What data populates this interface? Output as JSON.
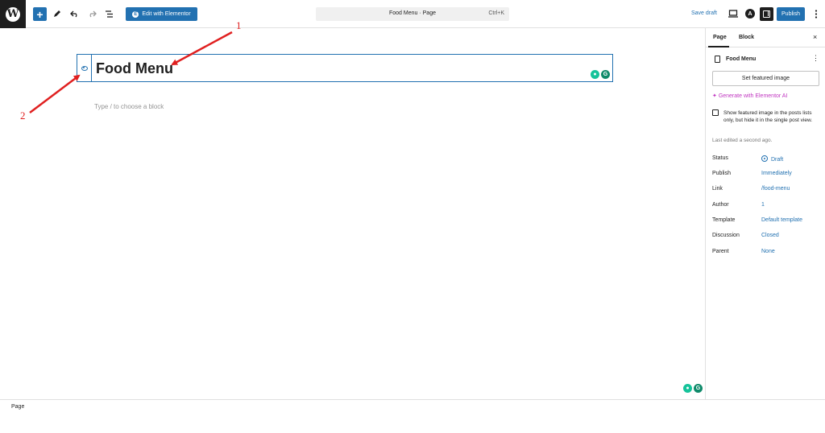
{
  "topbar": {
    "wp_logo": "W",
    "add_label": "+",
    "elementor_label": "Edit with Elementor",
    "command": {
      "title": "Food Menu · Page",
      "shortcut": "Ctrl+K"
    },
    "save_draft_label": "Save draft",
    "astra_label": "A",
    "publish_label": "Publish",
    "icons": [
      "wp-logo",
      "plus",
      "pencil",
      "undo",
      "redo",
      "list-view",
      "elementor",
      "desktop-view",
      "astra",
      "settings",
      "more-vertical"
    ]
  },
  "editor": {
    "title": "Food Menu",
    "block_placeholder": "Type / to choose a block",
    "grammarly_a": "●",
    "grammarly_b": "G"
  },
  "sidebar": {
    "tabs": [
      "Page",
      "Block"
    ],
    "active_tab": "Page",
    "close_label": "×",
    "doc_title": "Food Menu",
    "featured_image_label": "Set featured image",
    "generate_ai_label": "Generate with Elementor AI",
    "checkbox_label": "Show featured image in the posts lists only, but hide it in the single post view.",
    "last_edited": "Last edited a second ago.",
    "props": [
      {
        "label": "Status",
        "value": "Draft"
      },
      {
        "label": "Publish",
        "value": "Immediately"
      },
      {
        "label": "Link",
        "value": "/food-menu"
      },
      {
        "label": "Author",
        "value": "1"
      },
      {
        "label": "Template",
        "value": "Default template"
      },
      {
        "label": "Discussion",
        "value": "Closed"
      },
      {
        "label": "Parent",
        "value": "None"
      }
    ]
  },
  "footer": {
    "breadcrumb": "Page"
  },
  "annotations": [
    {
      "label": "1",
      "color": "#e02020"
    },
    {
      "label": "2",
      "color": "#e02020"
    }
  ],
  "colors": {
    "accent": "#2271b1",
    "ai": "#c036c0",
    "annotation": "#e02020",
    "grammarly": "#15c39a"
  }
}
